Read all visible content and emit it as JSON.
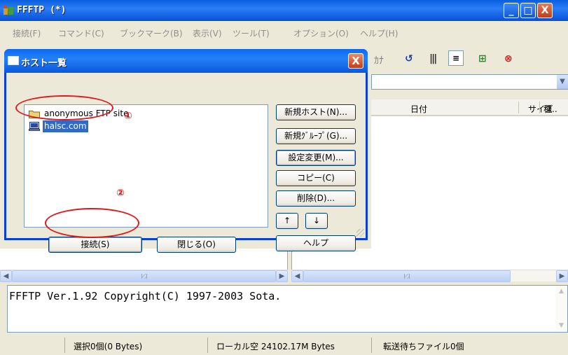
{
  "window": {
    "title": "FFFTP (*)",
    "controls": {
      "minimize": "_",
      "maximize": "□",
      "close": "X"
    }
  },
  "menu": [
    "接続(F)",
    "コマンド(C)",
    "ブックマーク(B)",
    "表示(V)",
    "ツール(T)",
    "オプション(O)",
    "ヘルプ(H)"
  ],
  "toolbar": {
    "kana_label": "ｶﾅ"
  },
  "remote": {
    "columns": {
      "date": "日付",
      "size": "サイズ",
      "type": "種.."
    }
  },
  "log": {
    "text": "FFFTP Ver.1.92 Copyright(C) 1997-2003 Sota."
  },
  "status": {
    "selection": "選択0個(0 Bytes)",
    "local_free": "ローカル空 24102.17M Bytes",
    "queue": "転送待ちファイル0個"
  },
  "dialog": {
    "title": "ホスト一覧",
    "close": "X",
    "hosts": [
      {
        "label": "anonymous FTP site",
        "icon": "folder-icon"
      },
      {
        "label": "halsc.com",
        "icon": "computer-icon",
        "selected": true
      }
    ],
    "buttons": {
      "new_host": "新規ホスト(N)...",
      "new_group": "新規ｸﾞﾙｰﾌﾟ(G)...",
      "edit": "設定変更(M)...",
      "copy": "コピー(C)",
      "delete": "削除(D)...",
      "up": "↑",
      "down": "↓",
      "help": "ヘルプ",
      "connect": "接続(S)",
      "close": "閉じる(O)"
    },
    "annotations": {
      "one": "①",
      "two": "②"
    }
  },
  "colors": {
    "titlebar": "#0a5fe0",
    "annotation": "#e0191f",
    "selection": "#316ac5"
  }
}
